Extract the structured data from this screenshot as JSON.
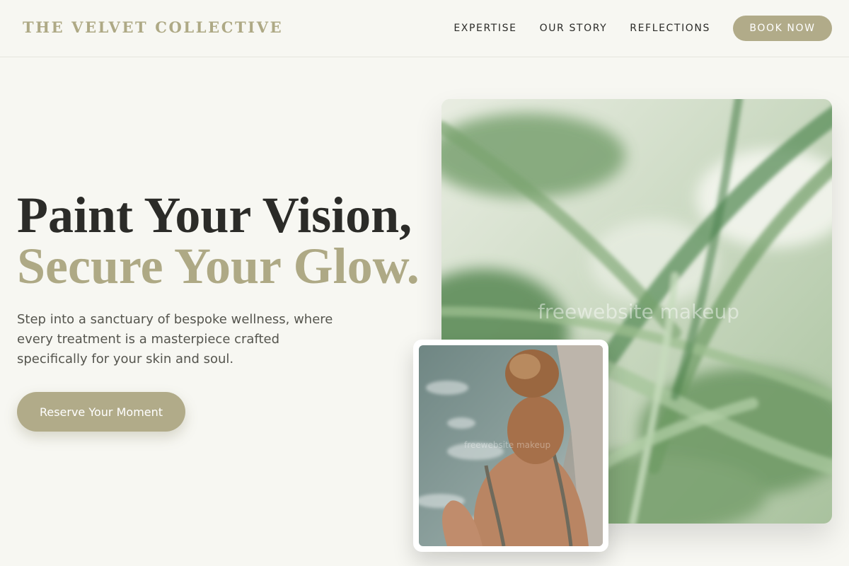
{
  "brand": {
    "name": "THE VELVET COLLECTIVE"
  },
  "nav": {
    "links": [
      "EXPERTISE",
      "OUR STORY",
      "REFLECTIONS"
    ],
    "cta": "BOOK NOW"
  },
  "hero": {
    "headline_line1": "Paint Your Vision,",
    "headline_line2": "Secure Your Glow.",
    "subtext": "Step into a sanctuary of bespoke wellness, where every treatment is a masterpiece crafted specifically for your skin and soul.",
    "cta": "Reserve Your Moment"
  },
  "images": {
    "large": {
      "alt": "palm-leaves-photo",
      "watermark": "freewebsite makeup"
    },
    "small": {
      "alt": "woman-in-spa-pool-photo",
      "watermark": "freewebsite makeup"
    }
  },
  "colors": {
    "accent": "#b1ab89",
    "background": "#f7f7f2",
    "text": "#2b2b28"
  }
}
